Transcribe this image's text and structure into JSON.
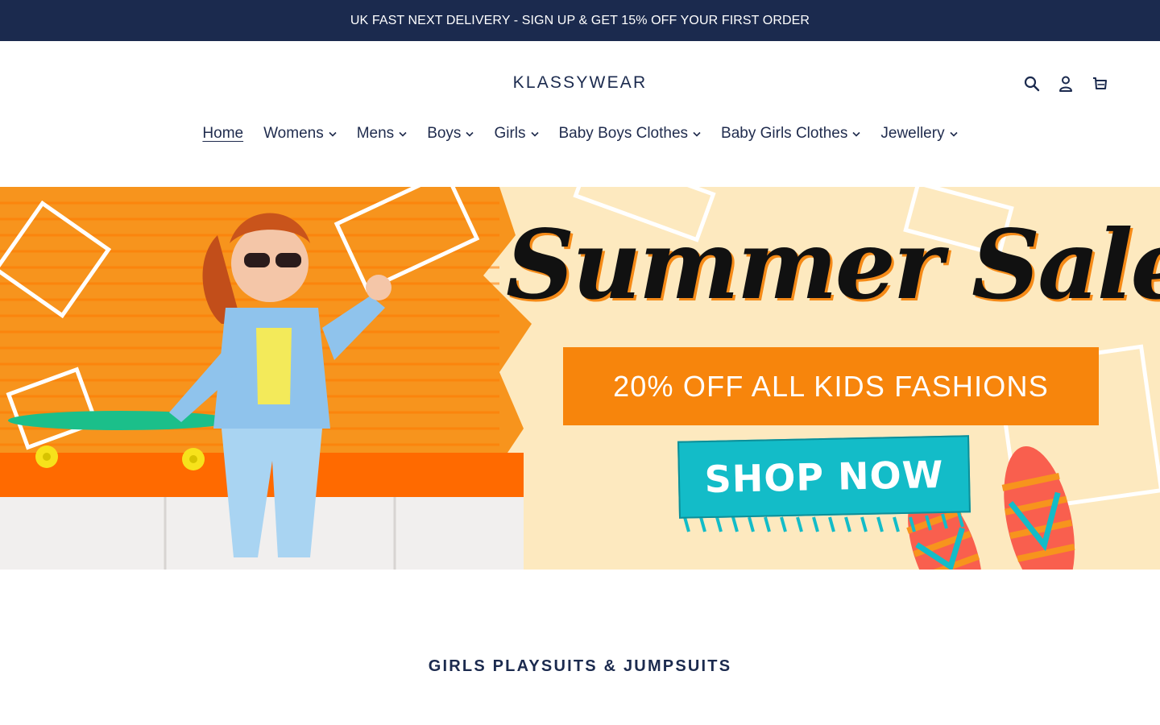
{
  "announcement": {
    "text": "UK FAST NEXT DELIVERY - SIGN UP & GET 15% OFF YOUR FIRST ORDER"
  },
  "header": {
    "logo": "KLASSYWEAR",
    "icons": [
      "search-icon",
      "account-icon",
      "cart-icon"
    ]
  },
  "nav": {
    "items": [
      {
        "label": "Home",
        "active": true,
        "dropdown": false
      },
      {
        "label": "Womens",
        "dropdown": true
      },
      {
        "label": "Mens",
        "dropdown": true
      },
      {
        "label": "Boys",
        "dropdown": true
      },
      {
        "label": "Girls",
        "dropdown": true
      },
      {
        "label": "Baby Boys Clothes",
        "dropdown": true
      },
      {
        "label": "Baby Girls Clothes",
        "dropdown": true
      },
      {
        "label": "Jewellery",
        "dropdown": true
      }
    ]
  },
  "hero": {
    "title": "Summer Sale.",
    "offer": "20% OFF ALL KIDS FASHIONS",
    "cta": "SHOP NOW"
  },
  "section": {
    "title": "GIRLS PLAYSUITS & JUMPSUITS"
  },
  "colors": {
    "navy": "#1b2a4e",
    "orange": "#f7850c",
    "teal": "#13bcc8",
    "cream": "#fde9bf"
  }
}
